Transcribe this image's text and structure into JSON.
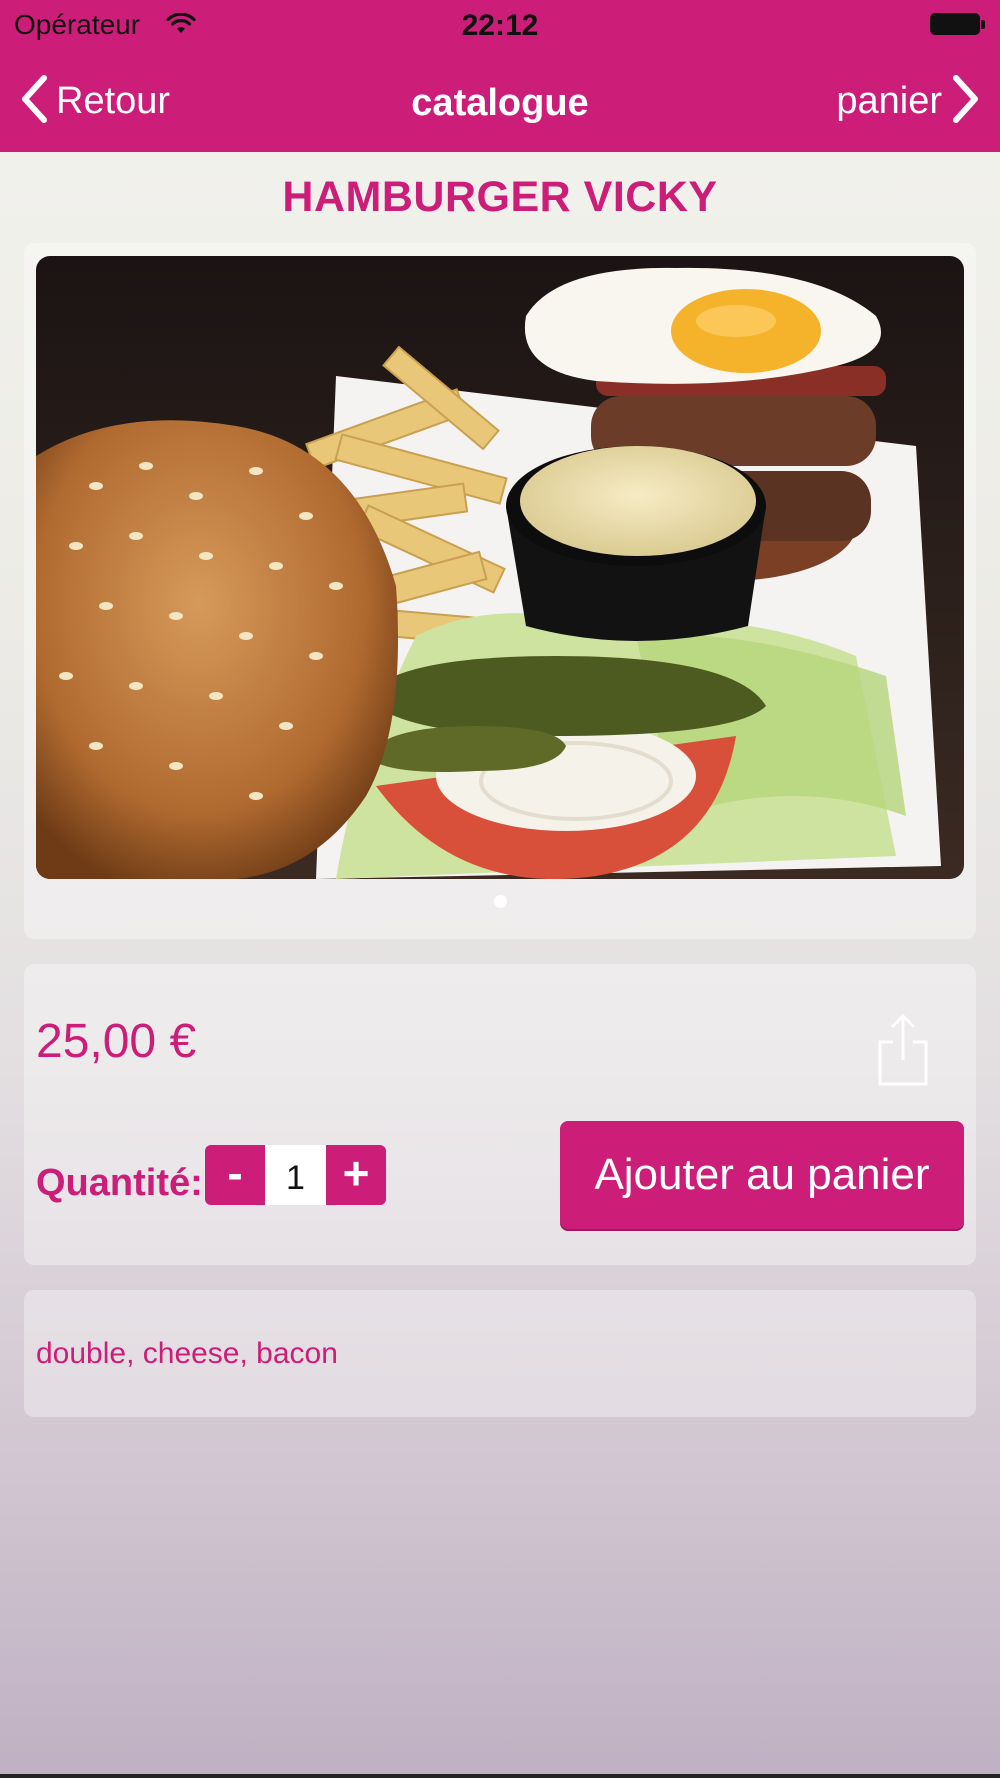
{
  "status_bar": {
    "carrier": "Opérateur",
    "time": "22:12"
  },
  "nav": {
    "back_label": "Retour",
    "title": "catalogue",
    "cart_label": "panier"
  },
  "product": {
    "name": "HAMBURGER VICKY",
    "price": "25,00 €",
    "quantity_label": "Quantité:",
    "quantity": "1",
    "minus_label": "-",
    "plus_label": "+",
    "add_to_cart_label": "Ajouter au panier",
    "description": "double, cheese, bacon",
    "image_page_count": 1,
    "image_current_page": 1
  },
  "icons": {
    "wifi": "wifi-icon",
    "battery": "battery-icon",
    "back": "chevron-left-icon",
    "cart": "chevron-right-icon",
    "share": "share-icon"
  },
  "colors": {
    "accent": "#cc1d78",
    "text_on_accent": "#ffffff"
  }
}
